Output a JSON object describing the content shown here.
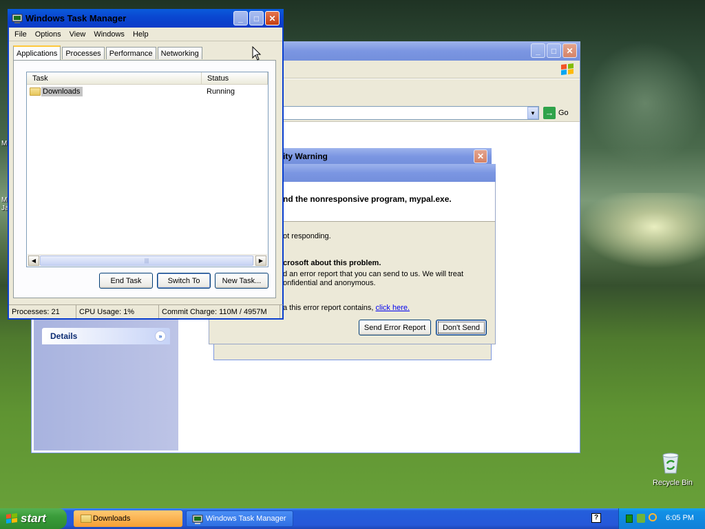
{
  "task_manager": {
    "title": "Windows Task Manager",
    "menu": [
      "File",
      "Options",
      "View",
      "Windows",
      "Help"
    ],
    "tabs": [
      "Applications",
      "Processes",
      "Performance",
      "Networking"
    ],
    "columns": [
      "Task",
      "Status"
    ],
    "rows": [
      {
        "task": "Downloads",
        "status": "Running"
      }
    ],
    "buttons": {
      "end_task": "End Task",
      "switch_to": "Switch To",
      "new_task": "New Task..."
    },
    "status": {
      "processes": "Processes: 21",
      "cpu": "CPU Usage: 1%",
      "commit": "Commit Charge: 110M / 4957M"
    }
  },
  "explorer": {
    "go": "Go",
    "details": "Details",
    "partial_letter": "o"
  },
  "security": {
    "title_partial": "urity Warning"
  },
  "error_dialog": {
    "headline_partial": "nd the nonresponsive program, mypal.exe.",
    "not_responding_partial": "ot responding.",
    "tell_partial": "crosoft about this problem.",
    "report_line1_partial": "d an error report that you can send to us.  We will treat",
    "report_line2_partial": "onfidential and anonymous.",
    "link_prefix_partial": "a this error report contains,",
    "link": "click here.",
    "send": "Send Error Report",
    "dont_send": "Don't Send"
  },
  "desktop": {
    "recycle_bin": "Recycle Bin",
    "edge_letters": [
      "M",
      "M",
      "Ja"
    ]
  },
  "taskbar": {
    "start": "start",
    "items": [
      "Downloads",
      "Windows Task Manager"
    ],
    "clock": "6:05 PM"
  }
}
